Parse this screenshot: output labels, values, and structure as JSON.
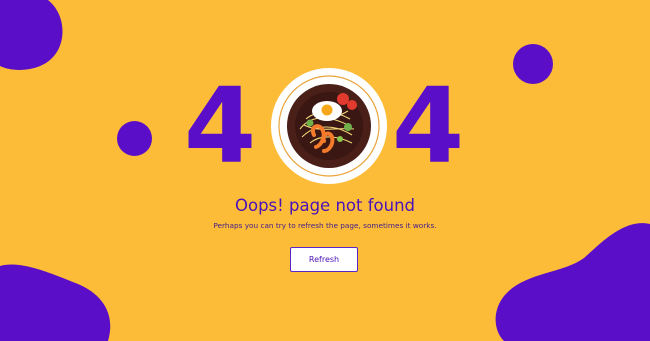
{
  "error": {
    "code_digit_left": "4",
    "code_digit_right": "4",
    "title": "Oops! page not found",
    "message": "Perhaps you can try to refresh the page, sometimes it works."
  },
  "actions": {
    "refresh_label": "Refresh"
  },
  "illustration": {
    "plate_icon": "spaghetti-plate-icon"
  },
  "colors": {
    "background": "#fdbc38",
    "accent": "#5a0ec8",
    "title": "#4a12b8",
    "message": "#3e1c8a",
    "button_text": "#4a12b8",
    "button_bg": "#ffffff"
  }
}
